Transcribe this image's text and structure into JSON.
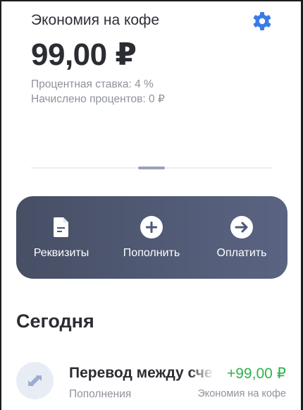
{
  "header": {
    "title": "Экономия на кофе",
    "amount": "99,00 ₽",
    "rate": "Процентная ставка: 4 %",
    "accrued": "Начислено процентов: 0 ₽",
    "settings_icon": "gear-icon",
    "accent_color": "#3a7be8"
  },
  "actions": [
    {
      "label": "Реквизиты",
      "icon": "document-icon"
    },
    {
      "label": "Пополнить",
      "icon": "plus-circle-icon"
    },
    {
      "label": "Оплатить",
      "icon": "arrow-right-circle-icon"
    }
  ],
  "section": {
    "title": "Сегодня"
  },
  "transactions": [
    {
      "title": "Перевод между счетами",
      "category": "Пополнения",
      "amount": "+99,00 ₽",
      "account": "Экономия на кофе",
      "icon": "transfer-arrows-icon",
      "amount_color": "#2fb24c"
    }
  ]
}
